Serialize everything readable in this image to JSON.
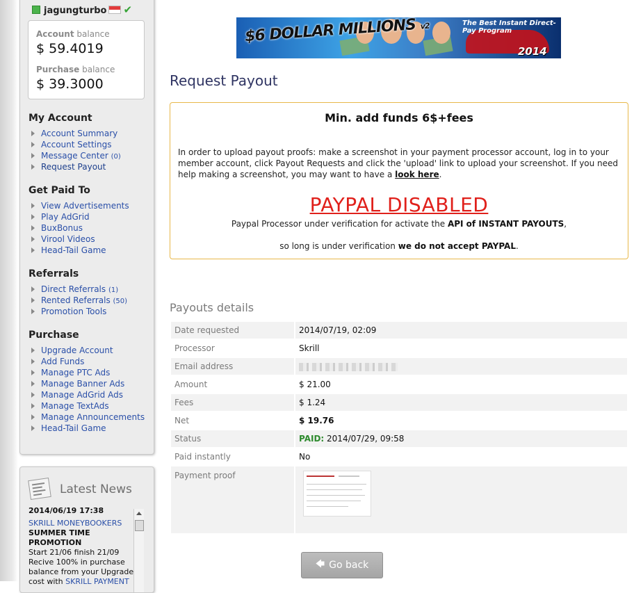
{
  "user": {
    "name": "jagungturbo"
  },
  "balances": {
    "account_label": "Account",
    "account_suffix": " balance",
    "account_value": "$ 59.4019",
    "purchase_label": "Purchase",
    "purchase_suffix": " balance",
    "purchase_value": "$ 39.3000"
  },
  "sidebar": {
    "my_account": {
      "title": "My Account",
      "items": [
        {
          "label": "Account Summary"
        },
        {
          "label": "Account Settings"
        },
        {
          "label": "Message Center",
          "count": "(0)"
        },
        {
          "label": "Request Payout"
        }
      ]
    },
    "get_paid": {
      "title": "Get Paid To",
      "items": [
        {
          "label": "View Advertisements"
        },
        {
          "label": "Play AdGrid"
        },
        {
          "label": "BuxBonus"
        },
        {
          "label": "Virool Videos"
        },
        {
          "label": "Head-Tail Game"
        }
      ]
    },
    "referrals": {
      "title": "Referrals",
      "items": [
        {
          "label": "Direct Referrals",
          "count": "(1)"
        },
        {
          "label": "Rented Referrals",
          "count": "(50)"
        },
        {
          "label": "Promotion Tools"
        }
      ]
    },
    "purchase": {
      "title": "Purchase",
      "items": [
        {
          "label": "Upgrade Account"
        },
        {
          "label": "Add Funds"
        },
        {
          "label": "Manage PTC Ads"
        },
        {
          "label": "Manage Banner Ads"
        },
        {
          "label": "Manage AdGrid Ads"
        },
        {
          "label": "Manage TextAds"
        },
        {
          "label": "Manage Announcements"
        },
        {
          "label": "Head-Tail Game"
        }
      ]
    }
  },
  "news": {
    "title": "Latest News",
    "date": "2014/06/19 17:38",
    "line1": "SKRILL MONEYBOOKERS",
    "line2": "SUMMER TIME PROMOTION",
    "line3": "Start 21/06 finish 21/09",
    "line4": "Recive 100% in purchase",
    "line5": "balance from your Upgrade",
    "line6a": "cost with ",
    "line6b": "SKRILL PAYMENT"
  },
  "banner": {
    "title": "$6 DOLLAR MILLIONS",
    "version": "v2",
    "tagline": "The Best Instant Direct-Pay Program",
    "year": "2014"
  },
  "main": {
    "page_title": "Request Payout",
    "notice": {
      "heading": "Min. add funds 6$+fees",
      "paragraph": "In order to upload payout proofs: make a screenshot in your payment processor account, log in to your member account, click Payout Requests and click the 'upload' link to upload your screenshot. If you need help making a screenshot, you may want to have a ",
      "link": "look here",
      "paragraph_end": ".",
      "big": "PAYPAL DISABLED",
      "line1a": "Paypal Processor under verification for activate the ",
      "line1b": "API of INSTANT PAYOUTS",
      "line1c": ",",
      "line2a": "so long is under verification ",
      "line2b": "we do not accept PAYPAL",
      "line2c": "."
    },
    "details_title": "Payouts details",
    "details": {
      "date_label": "Date requested",
      "date_value": "2014/07/19, 02:09",
      "processor_label": "Processor",
      "processor_value": "Skrill",
      "email_label": "Email address",
      "amount_label": "Amount",
      "amount_value": "$ 21.00",
      "fees_label": "Fees",
      "fees_value": "$ 1.24",
      "net_label": "Net",
      "net_value": "$ 19.76",
      "status_label": "Status",
      "status_paid": "PAID:",
      "status_value": " 2014/07/29, 09:58",
      "instant_label": "Paid instantly",
      "instant_value": "No",
      "proof_label": "Payment proof"
    },
    "go_back": "Go back"
  }
}
